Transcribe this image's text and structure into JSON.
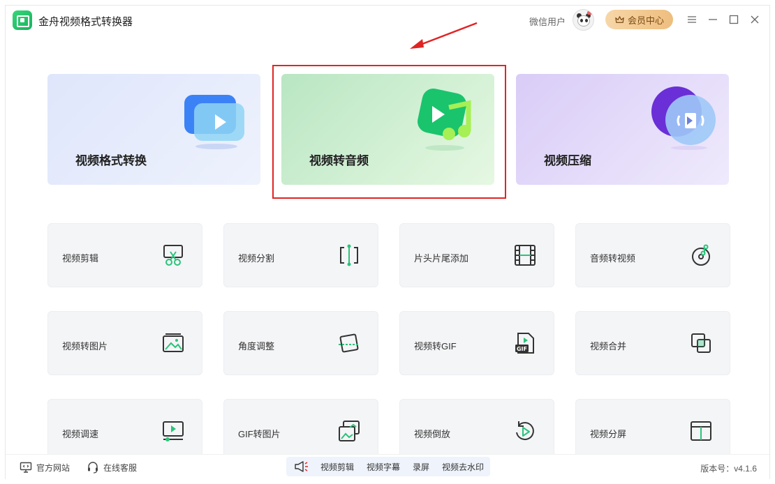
{
  "titlebar": {
    "app_title": "金舟视频格式转换器",
    "user_name": "微信用户",
    "vip_label": "会员中心"
  },
  "feature_cards": [
    {
      "label": "视频格式转换",
      "icon": "video-play-icon"
    },
    {
      "label": "视频转音频",
      "icon": "music-note-icon"
    },
    {
      "label": "视频压缩",
      "icon": "compress-icon"
    }
  ],
  "tools": [
    {
      "label": "视频剪辑",
      "icon": "scissors-icon"
    },
    {
      "label": "视频分割",
      "icon": "split-icon"
    },
    {
      "label": "片头片尾添加",
      "icon": "film-icon"
    },
    {
      "label": "音频转视频",
      "icon": "audio-disc-icon"
    },
    {
      "label": "视频转图片",
      "icon": "image-icon"
    },
    {
      "label": "角度调整",
      "icon": "rotate-frame-icon"
    },
    {
      "label": "视频转GIF",
      "icon": "gif-file-icon"
    },
    {
      "label": "视频合并",
      "icon": "merge-icon"
    },
    {
      "label": "视频调速",
      "icon": "speed-icon"
    },
    {
      "label": "GIF转图片",
      "icon": "gif-image-icon"
    },
    {
      "label": "视频倒放",
      "icon": "reverse-icon"
    },
    {
      "label": "视频分屏",
      "icon": "split-screen-icon"
    }
  ],
  "bottombar": {
    "website": "官方网站",
    "support": "在线客服",
    "quick_links": [
      "视频剪辑",
      "视频字幕",
      "录屏",
      "视频去水印"
    ],
    "version": "版本号：v4.1.6"
  },
  "colors": {
    "accent_green": "#2bc37a",
    "highlight_red": "#e02424",
    "vip_gold": "#eebe7e"
  }
}
